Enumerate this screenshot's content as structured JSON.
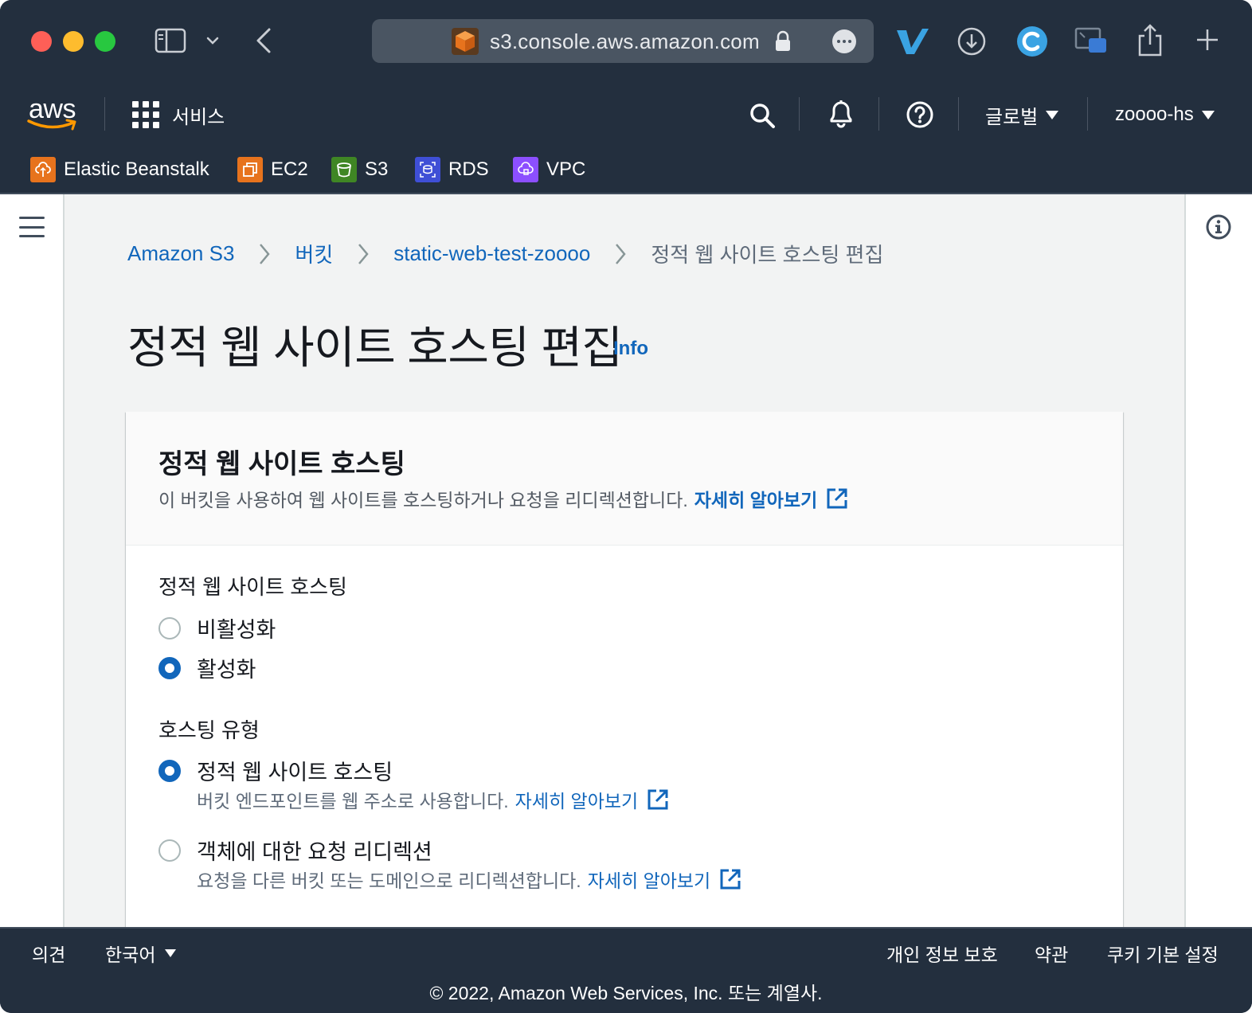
{
  "browser": {
    "url": "s3.console.aws.amazon.com"
  },
  "aws_nav": {
    "logo_text": "aws",
    "services_label": "서비스",
    "region_label": "글로벌",
    "account_label": "zoooo-hs"
  },
  "favorites": [
    {
      "label": "Elastic Beanstalk",
      "color": "#e7731d"
    },
    {
      "label": "EC2",
      "color": "#e7731d"
    },
    {
      "label": "S3",
      "color": "#3f8624"
    },
    {
      "label": "RDS",
      "color": "#3f4fd6"
    },
    {
      "label": "VPC",
      "color": "#8c4fff"
    }
  ],
  "breadcrumb": {
    "items": [
      "Amazon S3",
      "버킷",
      "static-web-test-zoooo"
    ],
    "current": "정적 웹 사이트 호스팅 편집"
  },
  "page": {
    "title": "정적 웹 사이트 호스팅 편집",
    "info_link": "Info"
  },
  "panel": {
    "title": "정적 웹 사이트 호스팅",
    "description": "이 버킷을 사용하여 웹 사이트를 호스팅하거나 요청을 리디렉션합니다.",
    "learn_more": "자세히 알아보기",
    "hosting_field": {
      "label": "정적 웹 사이트 호스팅",
      "options": [
        {
          "label": "비활성화",
          "checked": false
        },
        {
          "label": "활성화",
          "checked": true
        }
      ]
    },
    "type_field": {
      "label": "호스팅 유형",
      "options": [
        {
          "label": "정적 웹 사이트 호스팅",
          "desc": "버킷 엔드포인트를 웹 주소로 사용합니다.",
          "learn_more": "자세히 알아보기",
          "checked": true
        },
        {
          "label": "객체에 대한 요청 리디렉션",
          "desc": "요청을 다른 버킷 또는 도메인으로 리디렉션합니다.",
          "learn_more": "자세히 알아보기",
          "checked": false
        }
      ]
    }
  },
  "footer": {
    "feedback": "의견",
    "language": "한국어",
    "privacy": "개인 정보 보호",
    "terms": "약관",
    "cookies": "쿠키 기본 설정",
    "copyright": "© 2022, Amazon Web Services, Inc. 또는 계열사."
  },
  "colors": {
    "nav_bg": "#232f3e",
    "link": "#1166bb",
    "content_bg": "#f2f3f3"
  }
}
